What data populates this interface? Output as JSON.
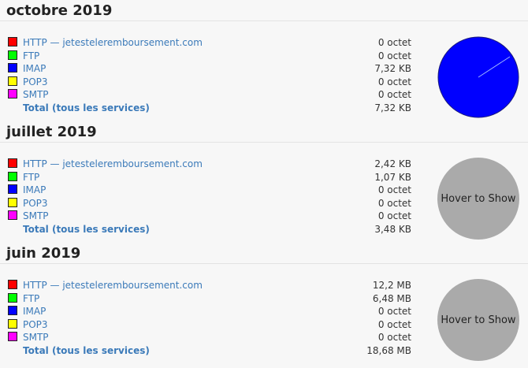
{
  "colors": {
    "http": "#ff0000",
    "ftp": "#00ff00",
    "imap": "#0000ff",
    "pop3": "#ffff00",
    "smtp": "#ff00ff",
    "link": "#3b7ab9",
    "hover_circle": "#aaaaaa"
  },
  "months": [
    {
      "title": "octobre 2019",
      "rows": [
        {
          "label": "HTTP — jetesteleremboursement.com",
          "value": "0 octet",
          "color_key": "http"
        },
        {
          "label": "FTP",
          "value": "0 octet",
          "color_key": "ftp"
        },
        {
          "label": "IMAP",
          "value": "7,32 KB",
          "color_key": "imap"
        },
        {
          "label": "POP3",
          "value": "0 octet",
          "color_key": "pop3"
        },
        {
          "label": "SMTP",
          "value": "0 octet",
          "color_key": "smtp"
        }
      ],
      "total": {
        "label": "Total (tous les services)",
        "value": "7,32 KB"
      },
      "pie_visible": true
    },
    {
      "title": "juillet 2019",
      "rows": [
        {
          "label": "HTTP — jetesteleremboursement.com",
          "value": "2,42 KB",
          "color_key": "http"
        },
        {
          "label": "FTP",
          "value": "1,07 KB",
          "color_key": "ftp"
        },
        {
          "label": "IMAP",
          "value": "0 octet",
          "color_key": "imap"
        },
        {
          "label": "POP3",
          "value": "0 octet",
          "color_key": "pop3"
        },
        {
          "label": "SMTP",
          "value": "0 octet",
          "color_key": "smtp"
        }
      ],
      "total": {
        "label": "Total (tous les services)",
        "value": "3,48 KB"
      },
      "pie_visible": false,
      "hover_text": "Hover to Show"
    },
    {
      "title": "juin 2019",
      "rows": [
        {
          "label": "HTTP — jetesteleremboursement.com",
          "value": "12,2 MB",
          "color_key": "http"
        },
        {
          "label": "FTP",
          "value": "6,48 MB",
          "color_key": "ftp"
        },
        {
          "label": "IMAP",
          "value": "0 octet",
          "color_key": "imap"
        },
        {
          "label": "POP3",
          "value": "0 octet",
          "color_key": "pop3"
        },
        {
          "label": "SMTP",
          "value": "0 octet",
          "color_key": "smtp"
        }
      ],
      "total": {
        "label": "Total (tous les services)",
        "value": "18,68 MB"
      },
      "pie_visible": false,
      "hover_text": "Hover to Show"
    }
  ]
}
